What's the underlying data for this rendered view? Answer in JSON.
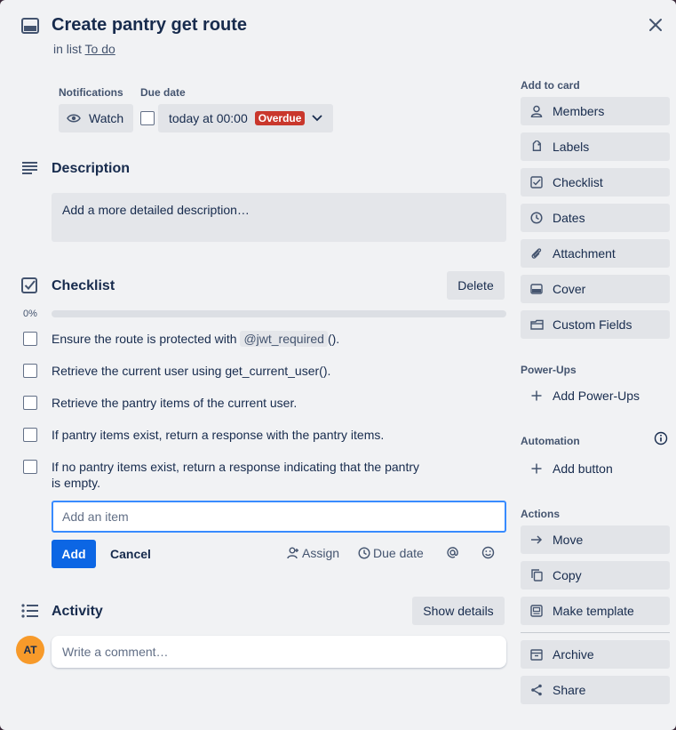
{
  "card": {
    "title": "Create pantry get route",
    "in_list_prefix": "in list",
    "list_name": "To do",
    "close_label": "×"
  },
  "header": {
    "notifications_label": "Notifications",
    "due_date_label": "Due date",
    "watch_label": "Watch",
    "due_value": "today at 00:00",
    "overdue_badge": "Overdue"
  },
  "description": {
    "title": "Description",
    "placeholder": "Add a more detailed description…"
  },
  "checklist": {
    "title": "Checklist",
    "delete_label": "Delete",
    "progress_text": "0%",
    "progress_value": 0,
    "items": [
      {
        "text_before": "Ensure the route is protected with",
        "code": "@jwt_required",
        "text_after": "()."
      },
      {
        "text": "Retrieve the current user using get_current_user()."
      },
      {
        "text": "Retrieve the pantry items of the current user."
      },
      {
        "text": "If pantry items exist, return a response with the pantry items."
      },
      {
        "text_line1": "If no pantry items exist, return a response indicating that the pantry",
        "text_line2": "is empty."
      }
    ],
    "add_item_placeholder": "Add an item",
    "add_label": "Add",
    "cancel_label": "Cancel",
    "assign_label": "Assign",
    "due_date_label": "Due date"
  },
  "activity": {
    "title": "Activity",
    "show_details_label": "Show details",
    "avatar_initials": "AT",
    "comment_placeholder": "Write a comment…"
  },
  "sidebar": {
    "add_to_card_label": "Add to card",
    "add_to_card": [
      {
        "label": "Members",
        "icon": "person-icon"
      },
      {
        "label": "Labels",
        "icon": "tag-icon"
      },
      {
        "label": "Checklist",
        "icon": "checkbox-icon"
      },
      {
        "label": "Dates",
        "icon": "clock-icon"
      },
      {
        "label": "Attachment",
        "icon": "paperclip-icon"
      },
      {
        "label": "Cover",
        "icon": "cover-icon"
      },
      {
        "label": "Custom Fields",
        "icon": "custom-fields-icon"
      }
    ],
    "powerups_label": "Power-Ups",
    "add_powerups_label": "Add Power-Ups",
    "automation_label": "Automation",
    "add_button_label": "Add button",
    "actions_label": "Actions",
    "actions": [
      {
        "label": "Move",
        "icon": "arrow-right-icon"
      },
      {
        "label": "Copy",
        "icon": "copy-icon"
      },
      {
        "label": "Make template",
        "icon": "template-icon"
      }
    ],
    "actions2": [
      {
        "label": "Archive",
        "icon": "archive-icon"
      },
      {
        "label": "Share",
        "icon": "share-icon"
      }
    ]
  },
  "colors": {
    "primary": "#0c66e4",
    "overdue": "#c9372c",
    "avatar": "#f79a2a",
    "focus": "#388bff"
  }
}
